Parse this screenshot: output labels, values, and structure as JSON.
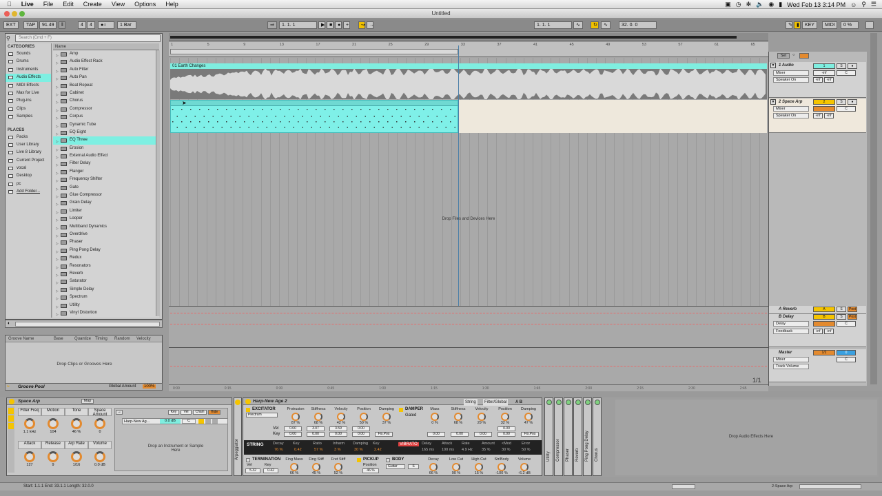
{
  "menubar": {
    "apple": "",
    "app": "Live",
    "items": [
      "File",
      "Edit",
      "Create",
      "View",
      "Options",
      "Help"
    ],
    "clock": "Wed Feb 13  3:14 PM"
  },
  "window": {
    "title": "Untitled"
  },
  "transport": {
    "ext": "EXT",
    "tap": "TAP",
    "tempo": "91.49",
    "sig_num": "4",
    "sig_den": "4",
    "quant": "1 Bar",
    "position": "1.   1.   1",
    "loop_start": "1.   1.   1",
    "loop_len": "32.   0.   0",
    "key": "KEY",
    "midi": "MIDI",
    "cpu": "0 %"
  },
  "browser": {
    "search_placeholder": "Search (Cmd + F)",
    "categories_header": "CATEGORIES",
    "categories": [
      "Sounds",
      "Drums",
      "Instruments",
      "Audio Effects",
      "MIDI Effects",
      "Max for Live",
      "Plug-ins",
      "Clips",
      "Samples"
    ],
    "selected_category": "Audio Effects",
    "places_header": "PLACES",
    "places": [
      "Packs",
      "User Library",
      "Live 8 Library",
      "Current Project",
      "vocal",
      "Desktop",
      "pc",
      "Add Folder..."
    ],
    "name_header": "Name",
    "items": [
      "Amp",
      "Audio Effect Rack",
      "Auto Filter",
      "Auto Pan",
      "Beat Repeat",
      "Cabinet",
      "Chorus",
      "Compressor",
      "Corpus",
      "Dynamic Tube",
      "EQ Eight",
      "EQ Three",
      "Erosion",
      "External Audio Effect",
      "Filter Delay",
      "Flanger",
      "Frequency Shifter",
      "Gate",
      "Glue Compressor",
      "Grain Delay",
      "Limiter",
      "Looper",
      "Multiband Dynamics",
      "Overdrive",
      "Phaser",
      "Ping Pong Delay",
      "Redux",
      "Resonators",
      "Reverb",
      "Saturator",
      "Simple Delay",
      "Spectrum",
      "Utility",
      "Vinyl Distortion"
    ],
    "selected_item": "EQ Three"
  },
  "groove": {
    "columns": [
      "Groove Name",
      "Base",
      "Quantize",
      "Timing",
      "Random",
      "Velocity"
    ],
    "drop_text": "Drop Clips or Grooves Here",
    "pool_label": "Groove Pool",
    "global_amount_label": "Global Amount",
    "global_amount": "100%"
  },
  "arrangement": {
    "bar_numbers": [
      "1",
      "5",
      "9",
      "13",
      "17",
      "21",
      "25",
      "29",
      "33",
      "37",
      "41",
      "45",
      "49",
      "53",
      "57",
      "61",
      "65"
    ],
    "clip1_name": "01 Earth Changes",
    "drop_text": "Drop Files and Devices Here",
    "time_marks": [
      "0:00",
      "0:15",
      "0:30",
      "0:45",
      "1:00",
      "1:15",
      "1:30",
      "1:45",
      "2:00",
      "2:15",
      "2:30",
      "2:45"
    ],
    "page": "1/1"
  },
  "mixer": {
    "set_label": "Set",
    "tracks": [
      {
        "name": "1 Audio",
        "number": "1",
        "device": "Mixer",
        "output": "Speaker On",
        "vol": "-inf",
        "pan": "C",
        "color": "#7feee0"
      },
      {
        "name": "2 Space Arp",
        "number": "2",
        "device": "Mixer",
        "output": "Speaker On",
        "vol": "-inf",
        "pan": "C",
        "color": "#f5c400"
      }
    ],
    "returns": [
      {
        "name": "A Reverb",
        "letter": "A",
        "device": "",
        "output": "",
        "post": "Post"
      },
      {
        "name": "B Delay",
        "letter": "B",
        "device": "Delay",
        "output": "Feedback",
        "post": "Post",
        "vol": "-inf",
        "pan": "C"
      }
    ],
    "master": {
      "name": "Master",
      "device": "Mixer",
      "output": "Track Volume",
      "cue": "1/2",
      "vol": "0",
      "pan": "C"
    }
  },
  "rack": {
    "name": "Space Arp",
    "map_label": "Map",
    "macros": [
      {
        "label": "Filter Freq",
        "value": "1.1 kHz"
      },
      {
        "label": "Motion",
        "value": "104"
      },
      {
        "label": "Tone",
        "value": "46 %"
      },
      {
        "label": "Space Amount",
        "value": "0"
      },
      {
        "label": "Attack",
        "value": "127"
      },
      {
        "label": "Release",
        "value": "9"
      },
      {
        "label": "Arp Rate",
        "value": "1/16"
      },
      {
        "label": "Volume",
        "value": "0.0 dB"
      }
    ],
    "chain_tabs": [
      "Key",
      "Vel",
      "Chain",
      "Hide"
    ],
    "chain_name": "Harp-New Ag...",
    "chain_vol": "0.0 dB",
    "chain_pan": "C",
    "drop_text": "Drop an Instrument or Sample Here"
  },
  "collision": {
    "name": "Harp-New Age 2",
    "tabs": [
      "String",
      "Filter/Global"
    ],
    "excitator": {
      "label": "EXCITATOR",
      "type": "Plectrum",
      "params": [
        {
          "name": "Protrusion",
          "value": "87 %"
        },
        {
          "name": "Stiffness",
          "value": "68 %"
        },
        {
          "name": "Velocity",
          "value": "42 %"
        },
        {
          "name": "Position",
          "value": "50 %"
        },
        {
          "name": "Damping",
          "value": "37 %"
        }
      ],
      "vel_values": [
        "0.00",
        "3.07",
        "3.59",
        "0.00"
      ],
      "key_values": [
        "0.00",
        "0.00",
        "0.00",
        "0.00"
      ],
      "fix_pos": "Fix.Pos",
      "vel_label": "Vel",
      "key_label": "Key"
    },
    "damper": {
      "label": "DAMPER",
      "gated": "Gated",
      "params": [
        {
          "name": "Mass",
          "value": "0 %"
        },
        {
          "name": "Stiffness",
          "value": "68 %"
        },
        {
          "name": "Velocity",
          "value": "29 %"
        },
        {
          "name": "Position",
          "value": "32 %"
        },
        {
          "name": "Damping",
          "value": "47 %"
        }
      ],
      "vel_values": [
        "0.00"
      ],
      "key_values": [
        "0.00",
        "0.00",
        "0.00",
        "0.00"
      ],
      "fix_pos": "Fix.Pos"
    },
    "string": {
      "label": "STRING",
      "params": [
        {
          "name": "Decay",
          "value": "76 %"
        },
        {
          "name": "Key",
          "value": "0.42"
        },
        {
          "name": "Ratio",
          "value": "57 %"
        },
        {
          "name": "Inharm",
          "value": "3 %"
        },
        {
          "name": "Damping",
          "value": "30 %"
        },
        {
          "name": "Key",
          "value": "2.42"
        }
      ],
      "vibrato": "VIBRATO",
      "vib_params": [
        {
          "name": "Delay",
          "value": "165 ms"
        },
        {
          "name": "Attack",
          "value": "100 ms"
        },
        {
          "name": "Rate",
          "value": "4.9 Hz"
        },
        {
          "name": "Amount",
          "value": "35 %"
        },
        {
          "name": "<Mod",
          "value": "30 %"
        },
        {
          "name": "Error",
          "value": "50 %"
        }
      ]
    },
    "termination": {
      "label": "TERMINATION",
      "vel_label": "Vel",
      "key_label": "Key",
      "vel": "5.32",
      "key": "0.42",
      "params": [
        {
          "name": "Fing Mass",
          "value": "66 %"
        },
        {
          "name": "Fing Stiff",
          "value": "45 %"
        },
        {
          "name": "Fret Stiff",
          "value": "52 %"
        }
      ]
    },
    "pickup": {
      "label": "PICKUP",
      "param": "Position",
      "value": "46 %"
    },
    "body": {
      "label": "BODY",
      "type": "Guitar",
      "size": "S",
      "params": [
        {
          "name": "Decay",
          "value": "66 %"
        },
        {
          "name": "Low Cut",
          "value": "90 %"
        },
        {
          "name": "High Cut",
          "value": "15 %"
        },
        {
          "name": "Str/Body",
          "value": "-100 %"
        },
        {
          "name": "Volume",
          "value": "-6.2 dB"
        }
      ]
    }
  },
  "effects_chain": [
    "Utility",
    "Compressor",
    "Phaser",
    "Reverb",
    "Ping Pong Delay",
    "Chorus"
  ],
  "arpeggiator_label": "Arpeggiator",
  "audio_fx_drop": "Drop Audio Effects Here",
  "status": {
    "selection": "Start: 1.1.1  End: 33.1.1  Length: 32.0.0",
    "track_label": "2-Space Arp"
  }
}
